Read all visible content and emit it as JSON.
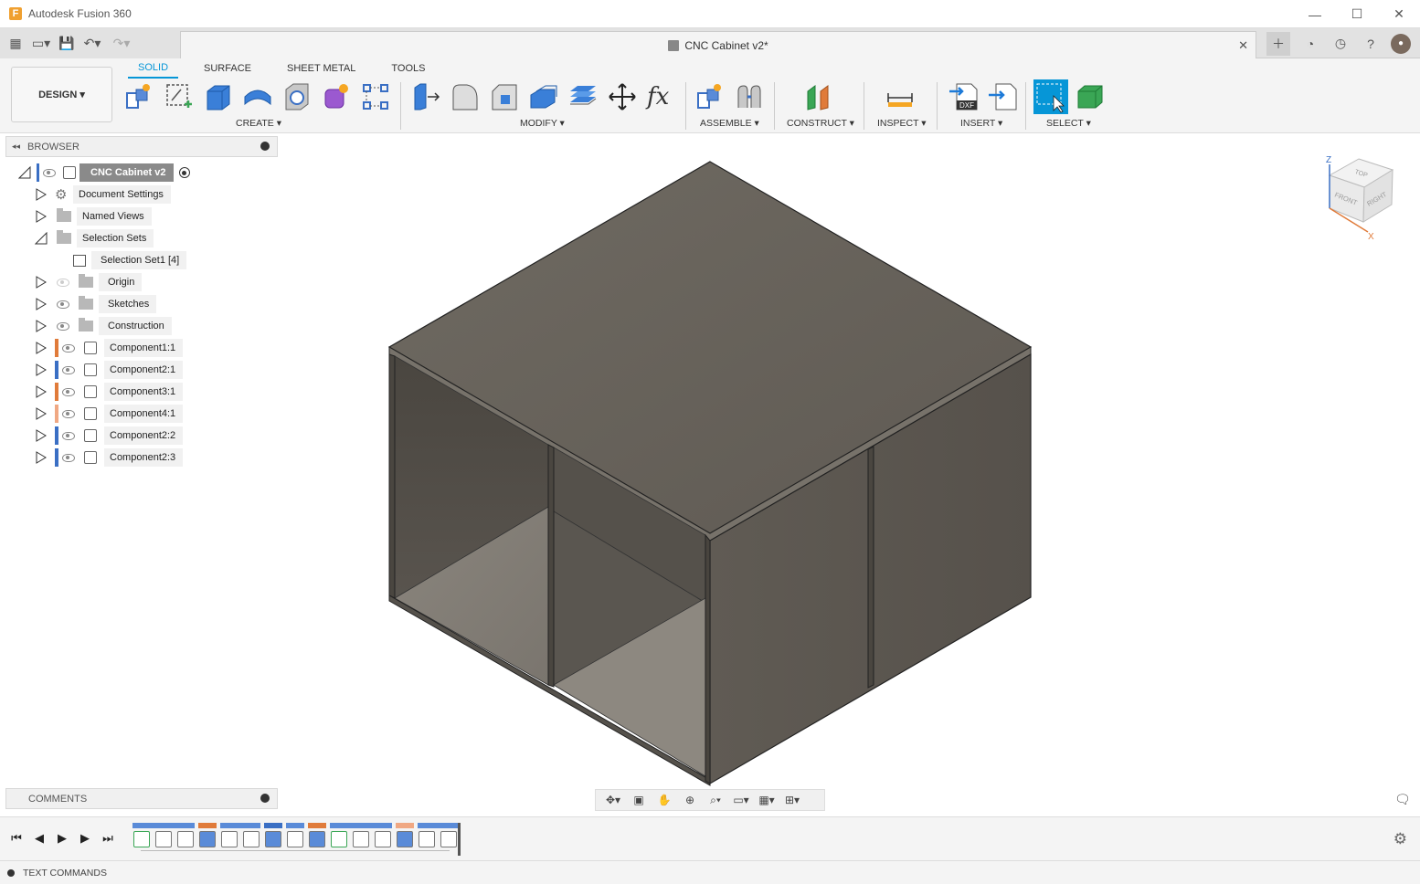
{
  "app": {
    "title": "Autodesk Fusion 360",
    "logo_letter": "F"
  },
  "window_controls": {
    "minimize": "—",
    "maximize": "☐",
    "close": "✕"
  },
  "document": {
    "tab_title": "CNC Cabinet v2*",
    "close_glyph": "✕"
  },
  "workspace": {
    "label": "DESIGN ▾"
  },
  "ribbon": {
    "tabs": [
      {
        "label": "SOLID",
        "active": true
      },
      {
        "label": "SURFACE",
        "active": false
      },
      {
        "label": "SHEET METAL",
        "active": false
      },
      {
        "label": "TOOLS",
        "active": false
      }
    ],
    "groups": {
      "create": "CREATE ▾",
      "modify": "MODIFY ▾",
      "assemble": "ASSEMBLE ▾",
      "construct": "CONSTRUCT ▾",
      "inspect": "INSPECT ▾",
      "insert": "INSERT ▾",
      "select": "SELECT ▾"
    },
    "insert_dxf_label": "DXF",
    "fx_label": "fx"
  },
  "browser": {
    "title": "BROWSER",
    "root": "CNC Cabinet v2",
    "items": [
      {
        "label": "Document Settings"
      },
      {
        "label": "Named Views"
      },
      {
        "label": "Selection Sets"
      },
      {
        "label": "Selection Set1 [4]"
      },
      {
        "label": "Origin"
      },
      {
        "label": "Sketches"
      },
      {
        "label": "Construction"
      },
      {
        "label": "Component1:1",
        "color": "#e07b3a"
      },
      {
        "label": "Component2:1",
        "color": "#3a6fc4"
      },
      {
        "label": "Component3:1",
        "color": "#e07b3a"
      },
      {
        "label": "Component4:1",
        "color": "#f0a883"
      },
      {
        "label": "Component2:2",
        "color": "#3a6fc4"
      },
      {
        "label": "Component2:3",
        "color": "#3a6fc4"
      }
    ]
  },
  "comments": {
    "title": "COMMENTS"
  },
  "viewcube": {
    "top": "TOP",
    "front": "FRONT",
    "right": "RIGHT",
    "axis_z": "Z",
    "axis_x": "X"
  },
  "text_commands": {
    "label": "TEXT COMMANDS"
  },
  "colors": {
    "accent": "#0696d7",
    "model_face": "#6b655e",
    "component_orange": "#e07b3a",
    "component_blue": "#3a6fc4"
  }
}
